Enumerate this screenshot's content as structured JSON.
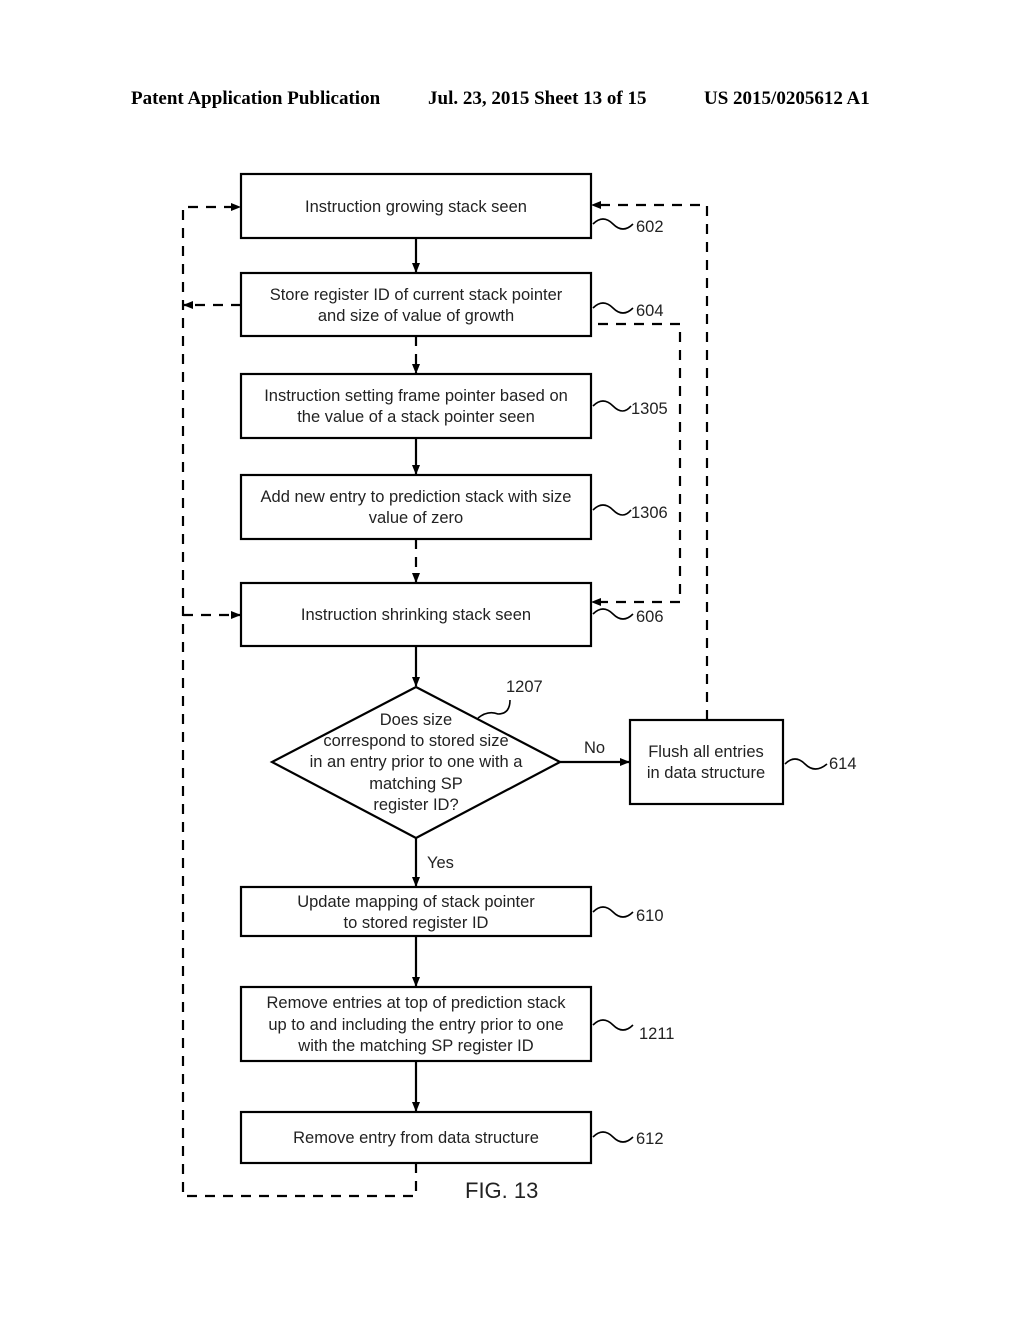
{
  "header": {
    "left": "Patent Application Publication",
    "middle": "Jul. 23, 2015   Sheet 13 of 15",
    "right": "US 2015/0205612 A1"
  },
  "figure": {
    "label": "FIG. 13",
    "nodes": [
      {
        "id": "602",
        "ref": "602",
        "lines": [
          "Instruction growing stack seen"
        ]
      },
      {
        "id": "604",
        "ref": "604",
        "lines": [
          "Store register ID of current stack pointer",
          "and size of value of growth"
        ]
      },
      {
        "id": "1305",
        "ref": "1305",
        "lines": [
          "Instruction setting frame pointer based on",
          "the value of a stack pointer seen"
        ]
      },
      {
        "id": "1306",
        "ref": "1306",
        "lines": [
          "Add new entry to prediction stack with size",
          "value of zero"
        ]
      },
      {
        "id": "606",
        "ref": "606",
        "lines": [
          "Instruction shrinking stack seen"
        ]
      },
      {
        "id": "1207",
        "ref": "1207",
        "type": "decision",
        "lines": [
          "Does size",
          "correspond to stored size",
          "in an entry prior to one with a",
          "matching SP",
          "register ID?"
        ]
      },
      {
        "id": "614",
        "ref": "614",
        "lines": [
          "Flush all entries",
          "in data structure"
        ]
      },
      {
        "id": "610",
        "ref": "610",
        "lines": [
          "Update mapping of stack pointer",
          "to stored register ID"
        ]
      },
      {
        "id": "1211",
        "ref": "1211",
        "lines": [
          "Remove entries at top of prediction stack",
          "up to and including the entry prior to one",
          "with the matching SP register ID"
        ]
      },
      {
        "id": "612",
        "ref": "612",
        "lines": [
          "Remove entry from data structure"
        ]
      }
    ],
    "edge_labels": {
      "no": "No",
      "yes": "Yes"
    }
  }
}
